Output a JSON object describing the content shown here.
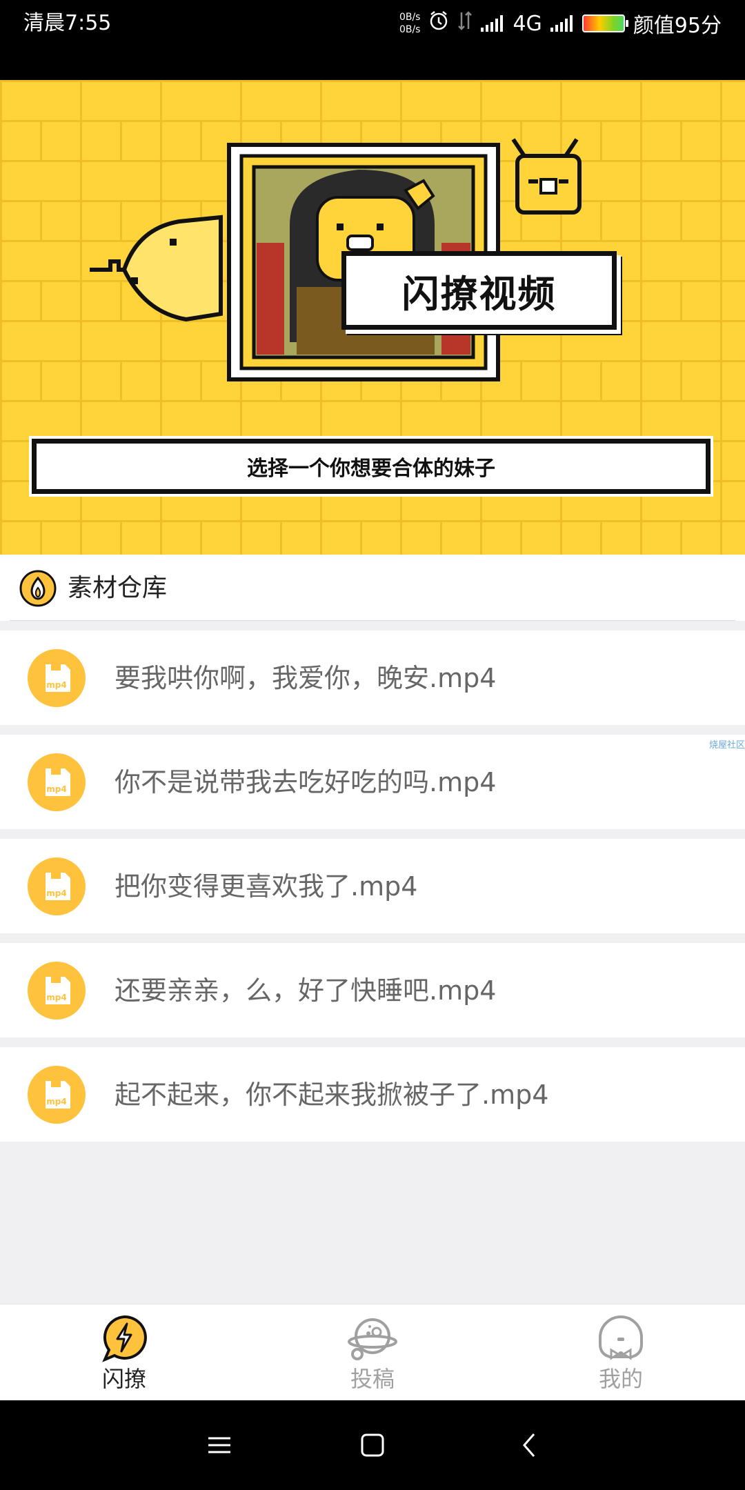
{
  "status_bar": {
    "time": "清晨7:55",
    "net_speed_up": "0B/s",
    "net_speed_down": "0B/s",
    "network_type": "4G",
    "battery_label": "颜值95分",
    "icons": [
      "alarm-icon",
      "data-arrows-icon",
      "signal-icon",
      "signal-icon",
      "battery-icon"
    ]
  },
  "hero": {
    "title": "闪撩视频",
    "subtitle": "选择一个你想要合体的妹子"
  },
  "section": {
    "icon": "flame-icon",
    "title": "素材仓库"
  },
  "files": [
    {
      "name": "要我哄你啊，我爱你，晚安.mp4",
      "icon": "mp4-file-icon"
    },
    {
      "name": "你不是说带我去吃好吃的吗.mp4",
      "icon": "mp4-file-icon"
    },
    {
      "name": "把你变得更喜欢我了.mp4",
      "icon": "mp4-file-icon"
    },
    {
      "name": "还要亲亲，么，好了快睡吧.mp4",
      "icon": "mp4-file-icon"
    },
    {
      "name": "起不起来，你不起来我掀被子了.mp4",
      "icon": "mp4-file-icon"
    }
  ],
  "watermark": "烧屋社区",
  "bottom_nav": [
    {
      "label": "闪撩",
      "icon": "lightning-bubble-icon",
      "active": true
    },
    {
      "label": "投稿",
      "icon": "planet-icon",
      "active": false
    },
    {
      "label": "我的",
      "icon": "face-bowtie-icon",
      "active": false
    }
  ],
  "system_nav": [
    "menu-icon",
    "home-icon",
    "back-icon"
  ],
  "colors": {
    "accent_yellow": "#ffd43a",
    "icon_orange": "#ffc23d",
    "text_gray": "#666666"
  }
}
